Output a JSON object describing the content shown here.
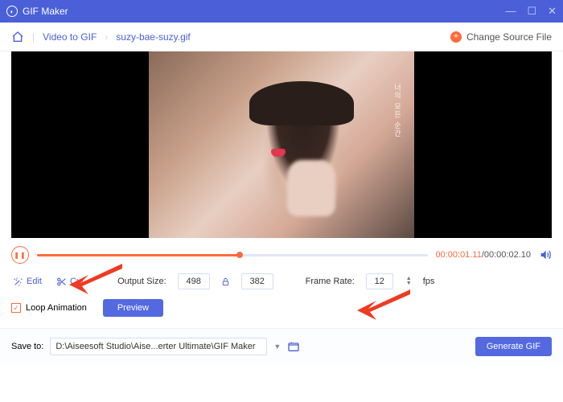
{
  "titlebar": {
    "app_name": "GIF Maker"
  },
  "topbar": {
    "crumb1": "Video to GIF",
    "crumb2": "suzy-bae-suzy.gif",
    "change_source": "Change Source File"
  },
  "video": {
    "side_text": "너의 모든 순간"
  },
  "playback": {
    "pause_glyph": "❚❚",
    "current": "00:00:01.11",
    "total": "00:00:02.10"
  },
  "controls": {
    "edit_label": "Edit",
    "cut_label": "Cut",
    "output_size_label": "Output Size:",
    "width": "498",
    "height": "382",
    "frame_rate_label": "Frame Rate:",
    "frame_rate": "12",
    "fps_label": "fps"
  },
  "options": {
    "loop_label": "Loop Animation",
    "preview_label": "Preview"
  },
  "save": {
    "label": "Save to:",
    "path": "D:\\Aiseesoft Studio\\Aise...erter Ultimate\\GIF Maker",
    "generate_label": "Generate GIF"
  }
}
